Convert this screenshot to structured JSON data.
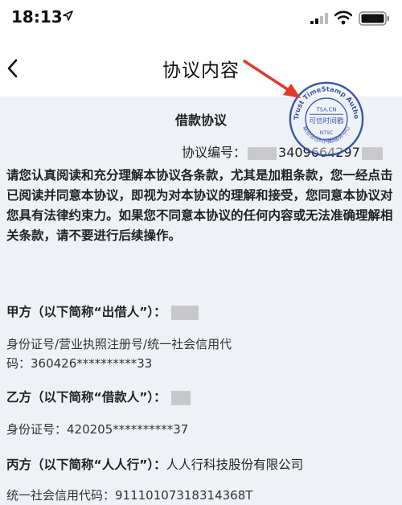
{
  "status_bar": {
    "time": "18:13"
  },
  "nav": {
    "title": "协议内容"
  },
  "document": {
    "title": "借款协议",
    "agreement_no_label": "协议编号：",
    "agreement_no_visible": "3409664297",
    "intro": "请您认真阅读和充分理解本协议各条款，尤其是加粗条款，您一经点击已阅读并同意本协议，即视为对本协议的理解和接受，您同意本协议对您具有法律约束力。如果您不同意本协议的任何内容或无法准确理解相关条款，请不要进行后续操作。",
    "party_a": {
      "label": "甲方（以下简称“出借人”）：",
      "id_line1": "身份证号/营业执照注册号/统一社会信用代",
      "id_line2": "码：360426**********33"
    },
    "party_b": {
      "label": "乙方（以下简称“借款人”）：",
      "id": "身份证号：420205**********37"
    },
    "party_c": {
      "label": "丙方（以下简称“人人行”）：",
      "name": "人人行科技股份有限公司",
      "credit_code": "统一社会信用代码：91110107318314368T"
    }
  },
  "seal": {
    "outer_text": "UniTrust TimeStamp Authority",
    "domain": "TSA.CN",
    "center": "可信时间戳",
    "bottom_code": "NTSC",
    "lower_arc": "联合信任时间戳服务中心"
  },
  "colors": {
    "content_bg": "#eef2f7",
    "seal_blue": "#2b4aa0",
    "arrow_red": "#e23a2b"
  }
}
